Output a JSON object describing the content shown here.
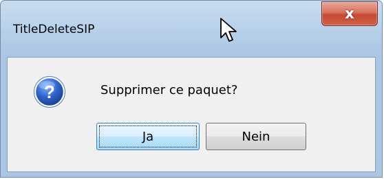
{
  "dialog": {
    "title": "TitleDeleteSIP",
    "close_label": "x",
    "message": "Supprimer ce paquet?",
    "icon": "question-icon",
    "buttons": {
      "yes_label": "Ja",
      "no_label": "Nein"
    }
  },
  "colors": {
    "accent": "#3c7fb1",
    "close_button": "#c54a34",
    "title_bar": "#b9d1ea",
    "client_bg": "#f0f0f0"
  }
}
